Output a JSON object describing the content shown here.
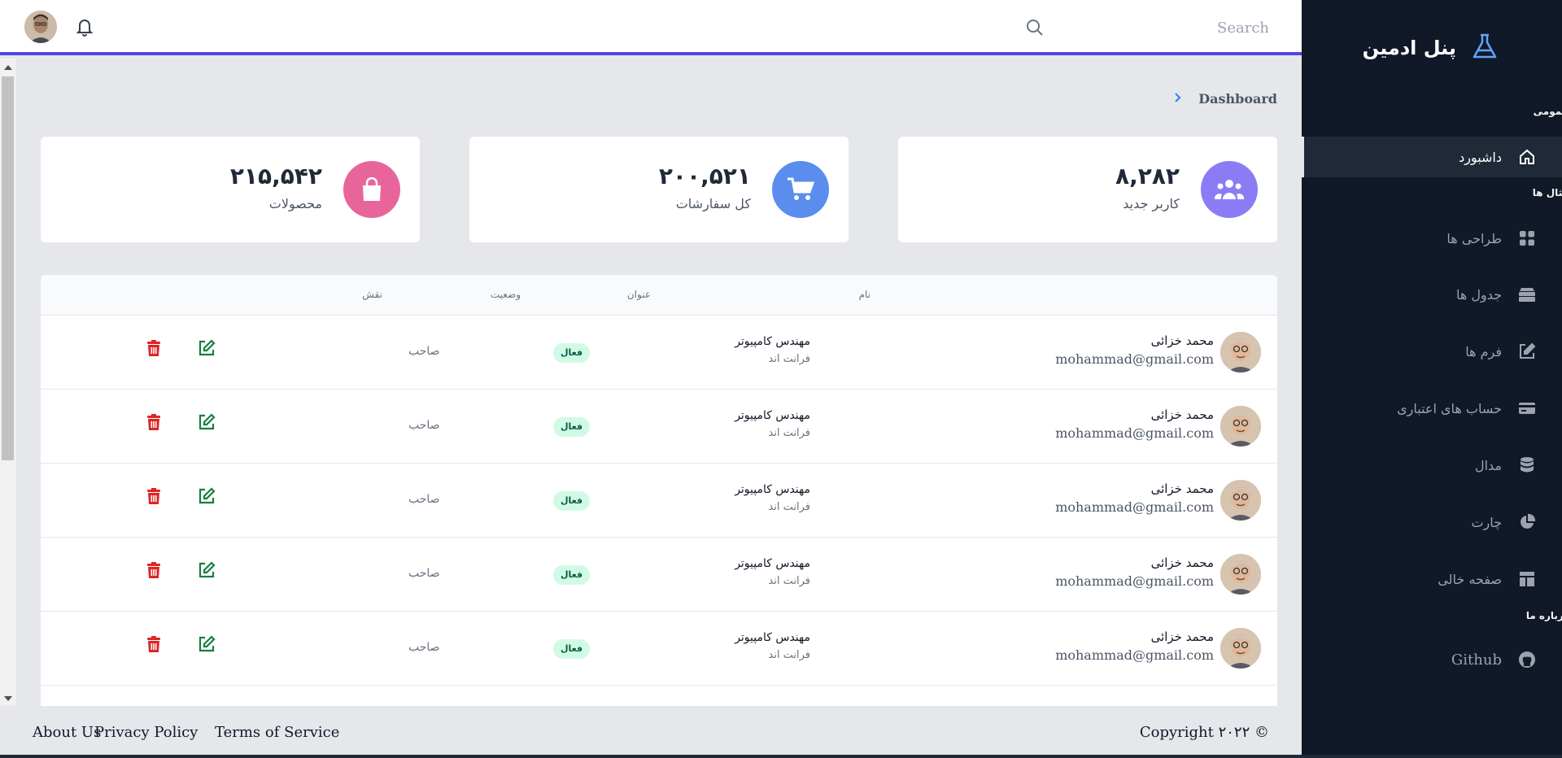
{
  "sidebar": {
    "brand_title": "پنل ادمین",
    "sections": [
      "عمومی",
      "مثال ها",
      "درباره ما"
    ],
    "items": [
      {
        "label": "داشبورد",
        "icon": "home-icon",
        "active": true
      },
      {
        "label": "طراحی ها",
        "icon": "grid-icon"
      },
      {
        "label": "جدول ها",
        "icon": "layers-icon"
      },
      {
        "label": "فرم ها",
        "icon": "edit-icon"
      },
      {
        "label": "حساب های اعتباری",
        "icon": "credit-card-icon"
      },
      {
        "label": "مدال",
        "icon": "database-icon"
      },
      {
        "label": "چارت",
        "icon": "pie-chart-icon"
      },
      {
        "label": "صفحه خالی",
        "icon": "layout-icon"
      },
      {
        "label": "Github",
        "icon": "github-icon"
      }
    ]
  },
  "header": {
    "search_placeholder": "Search"
  },
  "breadcrumb": "Dashboard",
  "cards": [
    {
      "value": "۸,۲۸۲",
      "label": "کاربر جدید",
      "icon": "users-icon",
      "color": "#8b7cf6"
    },
    {
      "value": "۲۰۰,۵۲۱",
      "label": "کل سفارشات",
      "icon": "cart-icon",
      "color": "#5b8def"
    },
    {
      "value": "۲۱۵,۵۴۲",
      "label": "محصولات",
      "icon": "shopping-bag-icon",
      "color": "#e8659c"
    }
  ],
  "table": {
    "headers": {
      "name": "نام",
      "title": "عنوان",
      "status": "وضعیت",
      "role": "نقش"
    },
    "rows": [
      {
        "name": "محمد خزائی",
        "email": "mohammad@gmail.com",
        "title": "مهندس کامپیوتر",
        "dept": "فرانت اند",
        "status": "فعال",
        "role": "صاحب"
      },
      {
        "name": "محمد خزائی",
        "email": "mohammad@gmail.com",
        "title": "مهندس کامپیوتر",
        "dept": "فرانت اند",
        "status": "فعال",
        "role": "صاحب"
      },
      {
        "name": "محمد خزائی",
        "email": "mohammad@gmail.com",
        "title": "مهندس کامپیوتر",
        "dept": "فرانت اند",
        "status": "فعال",
        "role": "صاحب"
      },
      {
        "name": "محمد خزائی",
        "email": "mohammad@gmail.com",
        "title": "مهندس کامپیوتر",
        "dept": "فرانت اند",
        "status": "فعال",
        "role": "صاحب"
      },
      {
        "name": "محمد خزائی",
        "email": "mohammad@gmail.com",
        "title": "مهندس کامپیوتر",
        "dept": "فرانت اند",
        "status": "فعال",
        "role": "صاحب"
      }
    ]
  },
  "footer": {
    "about": "About Us",
    "privacy": "Privacy Policy",
    "terms": "Terms of Service",
    "copyright": "Copyright ۲۰۲۲ ©"
  }
}
